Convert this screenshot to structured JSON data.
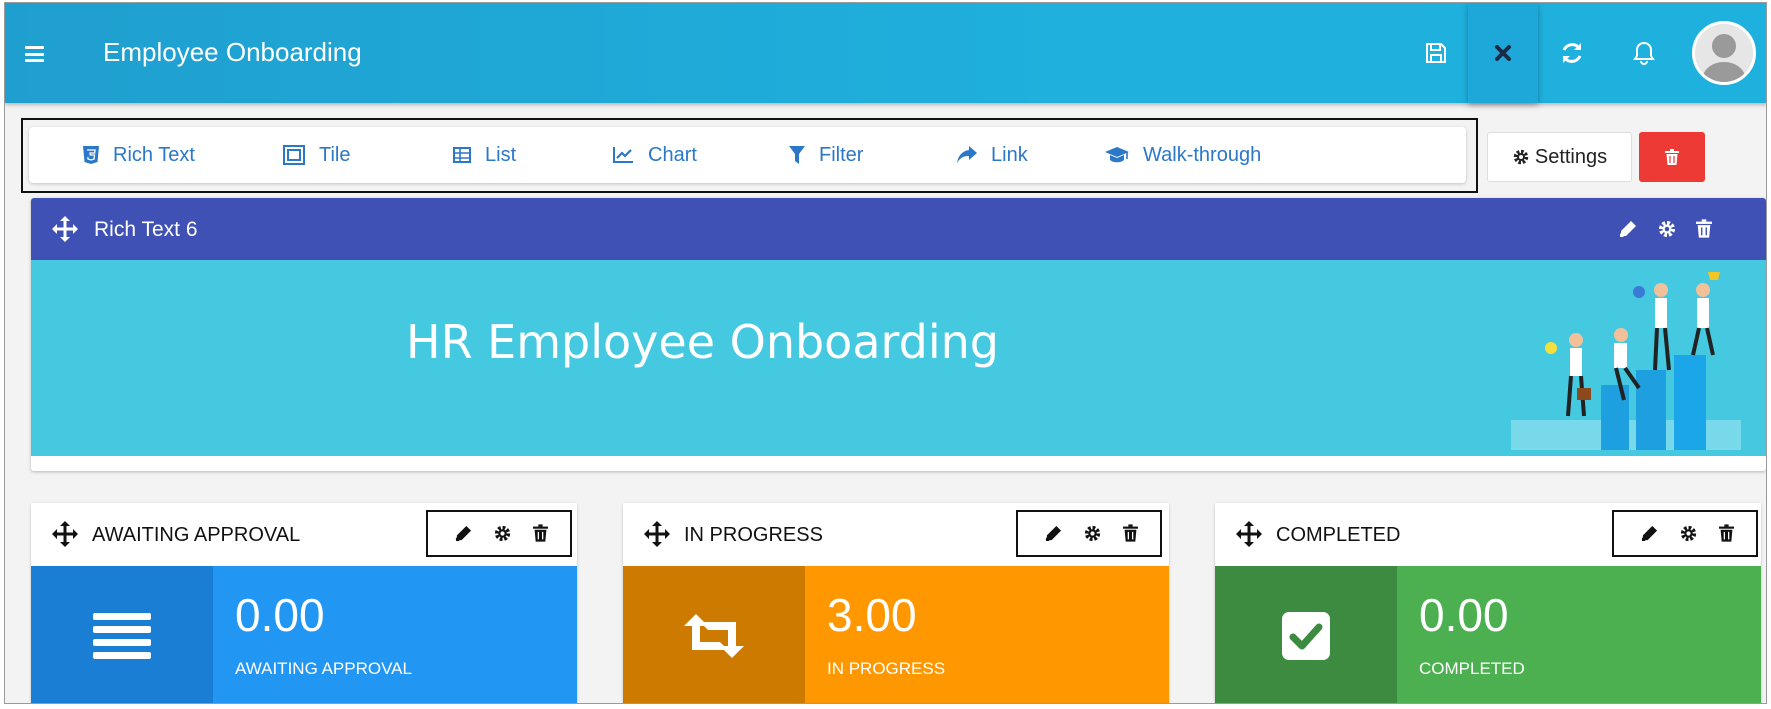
{
  "app": {
    "title": "Employee Onboarding"
  },
  "toolbar": {
    "items": [
      {
        "label": "Rich Text",
        "icon": "html5-icon"
      },
      {
        "label": "Tile",
        "icon": "tile-icon"
      },
      {
        "label": "List",
        "icon": "table-list-icon"
      },
      {
        "label": "Chart",
        "icon": "line-chart-icon"
      },
      {
        "label": "Filter",
        "icon": "filter-icon"
      },
      {
        "label": "Link",
        "icon": "share-link-icon"
      },
      {
        "label": "Walk-through",
        "icon": "graduation-cap-icon"
      }
    ],
    "settings_label": "Settings"
  },
  "richtext": {
    "title": "Rich Text 6",
    "banner_text": "HR Employee Onboarding"
  },
  "cards": [
    {
      "title": "AWAITING APPROVAL",
      "value": "0.00",
      "label": "AWAITING APPROVAL",
      "icon": "list-icon",
      "color_dark": "#1a7fd4",
      "color_light": "#2196f3"
    },
    {
      "title": "IN PROGRESS",
      "value": "3.00",
      "label": "IN PROGRESS",
      "icon": "retweet-icon",
      "color_dark": "#cc7a00",
      "color_light": "#ff9800"
    },
    {
      "title": "COMPLETED",
      "value": "0.00",
      "label": "COMPLETED",
      "icon": "check-square-icon",
      "color_dark": "#3d8b40",
      "color_light": "#4caf50"
    }
  ],
  "colors": {
    "topbar": "#1fa8d8",
    "toolbar_text": "#2b77c8",
    "panel_header": "#4051b5",
    "banner": "#45c9e1",
    "delete": "#ee3a34"
  }
}
